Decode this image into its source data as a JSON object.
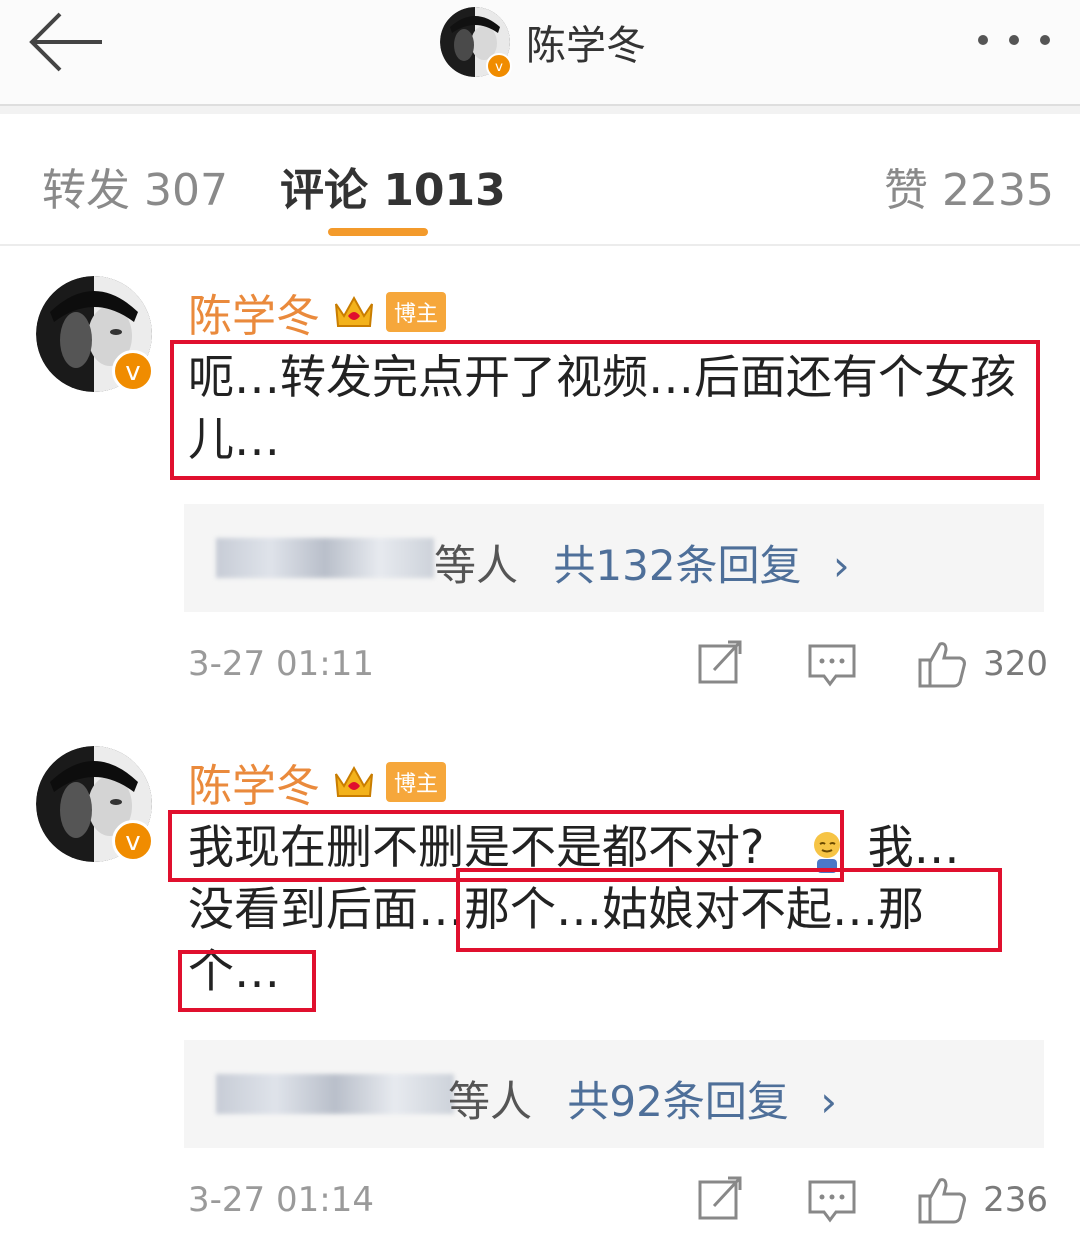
{
  "header": {
    "title": "陈学冬",
    "back_icon": "arrow-left-icon",
    "more_icon": "more-dots-icon"
  },
  "tabs": [
    {
      "label": "转发 307"
    },
    {
      "label": "评论 1013"
    },
    {
      "label": "赞 2235"
    }
  ],
  "colors": {
    "accent": "#f39a2b",
    "name": "#ea8a3c",
    "highlight": "#e0102e",
    "link": "#4e6f99"
  },
  "comments": [
    {
      "author": "陈学冬",
      "badge": "博主",
      "text": "呃…转发完点开了视频…后面还有个女孩儿…",
      "reply_who": "等人",
      "reply_count": "共132条回复",
      "chevron": "›",
      "time": "3-27 01:11",
      "likes": "320"
    },
    {
      "author": "陈学冬",
      "badge": "博主",
      "text_part1": "我现在删不删是不是都不对?",
      "text_part2": "我…",
      "text_line2": "没看到后面…那个…姑娘对不起…那",
      "text_line3": "个…",
      "reply_who": "等人",
      "reply_count": "共92条回复",
      "chevron": "›",
      "time": "3-27 01:14",
      "likes": "236"
    }
  ]
}
